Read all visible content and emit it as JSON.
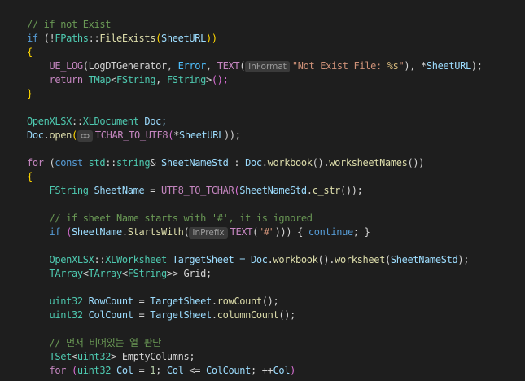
{
  "colors": {
    "background": "#1e1e1e",
    "keyword": "#569cd6",
    "control": "#c586c0",
    "type": "#4ec9b0",
    "function": "#dcdcaa",
    "variable": "#9cdcfe",
    "string": "#ce9178",
    "comment": "#6a9955"
  },
  "hint_icon": "link-icon",
  "lines": [
    [
      {
        "t": "// if not Exist",
        "c": "cmt"
      }
    ],
    [
      {
        "t": "if",
        "c": "kw"
      },
      {
        "t": " (!",
        "c": "pun"
      },
      {
        "t": "FPaths",
        "c": "typ"
      },
      {
        "t": "::",
        "c": "pun"
      },
      {
        "t": "FileExists",
        "c": "fn"
      },
      {
        "t": "(",
        "c": "ylw"
      },
      {
        "t": "SheetURL",
        "c": "var"
      },
      {
        "t": "))",
        "c": "ylw"
      }
    ],
    [
      {
        "t": "{",
        "c": "ylw"
      }
    ],
    [
      {
        "t": "    ",
        "c": "pun"
      },
      {
        "t": "UE_LOG",
        "c": "mac"
      },
      {
        "t": "(LogDTGenerator, ",
        "c": "pun"
      },
      {
        "t": "Error",
        "c": "enm"
      },
      {
        "t": ", ",
        "c": "pun"
      },
      {
        "t": "TEXT",
        "c": "mac"
      },
      {
        "t": "(",
        "c": "pun"
      },
      {
        "h": "InFormat"
      },
      {
        "t": "\"Not Exist File: ",
        "c": "str"
      },
      {
        "t": "%s",
        "c": "fmt"
      },
      {
        "t": "\"",
        "c": "str"
      },
      {
        "t": "), ",
        "c": "pun"
      },
      {
        "t": "*",
        "c": "pun"
      },
      {
        "t": "SheetURL",
        "c": "var"
      },
      {
        "t": ");",
        "c": "pun"
      }
    ],
    [
      {
        "t": "    ",
        "c": "pun"
      },
      {
        "t": "return",
        "c": "ctl"
      },
      {
        "t": " ",
        "c": "pun"
      },
      {
        "t": "TMap",
        "c": "typ"
      },
      {
        "t": "<",
        "c": "pun"
      },
      {
        "t": "FString",
        "c": "typ"
      },
      {
        "t": ", ",
        "c": "pun"
      },
      {
        "t": "FString",
        "c": "typ"
      },
      {
        "t": ">",
        "c": "pun"
      },
      {
        "t": "();",
        "c": "pnk"
      }
    ],
    [
      {
        "t": "}",
        "c": "ylw"
      }
    ],
    [],
    [
      {
        "t": "OpenXLSX",
        "c": "typ"
      },
      {
        "t": "::",
        "c": "pun"
      },
      {
        "t": "XLDocument",
        "c": "typ"
      },
      {
        "t": " Doc;",
        "c": "var"
      }
    ],
    [
      {
        "t": "Doc",
        "c": "var"
      },
      {
        "t": ".",
        "c": "pun"
      },
      {
        "t": "open",
        "c": "fn"
      },
      {
        "t": "(",
        "c": "ylw"
      },
      {
        "i": true
      },
      {
        "t": "TCHAR_TO_UTF8",
        "c": "mac"
      },
      {
        "t": "(",
        "c": "pnk"
      },
      {
        "t": "*",
        "c": "pun"
      },
      {
        "t": "SheetURL",
        "c": "var"
      },
      {
        "t": "));",
        "c": "pun"
      }
    ],
    [],
    [
      {
        "t": "for",
        "c": "ctl"
      },
      {
        "t": " (",
        "c": "pun"
      },
      {
        "t": "const",
        "c": "kw"
      },
      {
        "t": " std",
        "c": "typ"
      },
      {
        "t": "::",
        "c": "pun"
      },
      {
        "t": "string",
        "c": "typ"
      },
      {
        "t": "& ",
        "c": "pun"
      },
      {
        "t": "SheetNameStd",
        "c": "var"
      },
      {
        "t": " : ",
        "c": "pun"
      },
      {
        "t": "Doc",
        "c": "var"
      },
      {
        "t": ".",
        "c": "pun"
      },
      {
        "t": "workbook",
        "c": "fn"
      },
      {
        "t": "().",
        "c": "pun"
      },
      {
        "t": "worksheetNames",
        "c": "fn"
      },
      {
        "t": "())",
        "c": "pun"
      }
    ],
    [
      {
        "t": "{",
        "c": "ylw"
      }
    ],
    [
      {
        "t": "    ",
        "c": "pun"
      },
      {
        "t": "FString",
        "c": "typ"
      },
      {
        "t": " ",
        "c": "pun"
      },
      {
        "t": "SheetName",
        "c": "var"
      },
      {
        "t": " = ",
        "c": "pun"
      },
      {
        "t": "UTF8_TO_TCHAR",
        "c": "mac"
      },
      {
        "t": "(",
        "c": "pnk"
      },
      {
        "t": "SheetNameStd",
        "c": "var"
      },
      {
        "t": ".",
        "c": "pun"
      },
      {
        "t": "c_str",
        "c": "fn"
      },
      {
        "t": "());",
        "c": "pun"
      }
    ],
    [],
    [
      {
        "t": "    ",
        "c": "pun"
      },
      {
        "t": "// if sheet Name starts with '#', it is ignored",
        "c": "cmt"
      }
    ],
    [
      {
        "t": "    ",
        "c": "pun"
      },
      {
        "t": "if",
        "c": "kw"
      },
      {
        "t": " (",
        "c": "pnk"
      },
      {
        "t": "SheetName",
        "c": "var"
      },
      {
        "t": ".",
        "c": "pun"
      },
      {
        "t": "StartsWith",
        "c": "fn"
      },
      {
        "t": "(",
        "c": "pun"
      },
      {
        "h": "InPrefix"
      },
      {
        "t": "TEXT",
        "c": "mac"
      },
      {
        "t": "(",
        "c": "pun"
      },
      {
        "t": "\"#\"",
        "c": "str"
      },
      {
        "t": "))) { ",
        "c": "pun"
      },
      {
        "t": "continue",
        "c": "kw"
      },
      {
        "t": "; }",
        "c": "pun"
      }
    ],
    [],
    [
      {
        "t": "    ",
        "c": "pun"
      },
      {
        "t": "OpenXLSX",
        "c": "typ"
      },
      {
        "t": "::",
        "c": "pun"
      },
      {
        "t": "XLWorksheet",
        "c": "typ"
      },
      {
        "t": " TargetSheet = ",
        "c": "var"
      },
      {
        "t": "Doc",
        "c": "var"
      },
      {
        "t": ".",
        "c": "pun"
      },
      {
        "t": "workbook",
        "c": "fn"
      },
      {
        "t": "().",
        "c": "pun"
      },
      {
        "t": "worksheet",
        "c": "fn"
      },
      {
        "t": "(",
        "c": "pun"
      },
      {
        "t": "SheetNameStd",
        "c": "var"
      },
      {
        "t": ");",
        "c": "pun"
      }
    ],
    [
      {
        "t": "    ",
        "c": "pun"
      },
      {
        "t": "TArray",
        "c": "typ"
      },
      {
        "t": "<",
        "c": "pun"
      },
      {
        "t": "TArray",
        "c": "typ"
      },
      {
        "t": "<",
        "c": "pun"
      },
      {
        "t": "FString",
        "c": "typ"
      },
      {
        "t": ">> Grid;",
        "c": "pun"
      }
    ],
    [],
    [
      {
        "t": "    ",
        "c": "pun"
      },
      {
        "t": "uint32",
        "c": "typ"
      },
      {
        "t": " ",
        "c": "pun"
      },
      {
        "t": "RowCount",
        "c": "var"
      },
      {
        "t": " = ",
        "c": "pun"
      },
      {
        "t": "TargetSheet",
        "c": "var"
      },
      {
        "t": ".",
        "c": "pun"
      },
      {
        "t": "rowCount",
        "c": "fn"
      },
      {
        "t": "();",
        "c": "pun"
      }
    ],
    [
      {
        "t": "    ",
        "c": "pun"
      },
      {
        "t": "uint32",
        "c": "typ"
      },
      {
        "t": " ",
        "c": "pun"
      },
      {
        "t": "ColCount",
        "c": "var"
      },
      {
        "t": " = ",
        "c": "pun"
      },
      {
        "t": "TargetSheet",
        "c": "var"
      },
      {
        "t": ".",
        "c": "pun"
      },
      {
        "t": "columnCount",
        "c": "fn"
      },
      {
        "t": "();",
        "c": "pun"
      }
    ],
    [],
    [
      {
        "t": "    ",
        "c": "pun"
      },
      {
        "t": "// 먼저 비어있는 열 판단",
        "c": "cmt"
      }
    ],
    [
      {
        "t": "    ",
        "c": "pun"
      },
      {
        "t": "TSet",
        "c": "typ"
      },
      {
        "t": "<",
        "c": "pun"
      },
      {
        "t": "uint32",
        "c": "typ"
      },
      {
        "t": "> EmptyColumns;",
        "c": "pun"
      }
    ],
    [
      {
        "t": "    ",
        "c": "pun"
      },
      {
        "t": "for",
        "c": "ctl"
      },
      {
        "t": " (",
        "c": "pnk"
      },
      {
        "t": "uint32",
        "c": "typ"
      },
      {
        "t": " ",
        "c": "pun"
      },
      {
        "t": "Col",
        "c": "var"
      },
      {
        "t": " = ",
        "c": "pun"
      },
      {
        "t": "1",
        "c": "num"
      },
      {
        "t": "; ",
        "c": "pun"
      },
      {
        "t": "Col",
        "c": "var"
      },
      {
        "t": " <= ",
        "c": "pun"
      },
      {
        "t": "ColCount",
        "c": "var"
      },
      {
        "t": "; ++",
        "c": "pun"
      },
      {
        "t": "Col",
        "c": "var"
      },
      {
        "t": ")",
        "c": "pnk"
      }
    ]
  ]
}
